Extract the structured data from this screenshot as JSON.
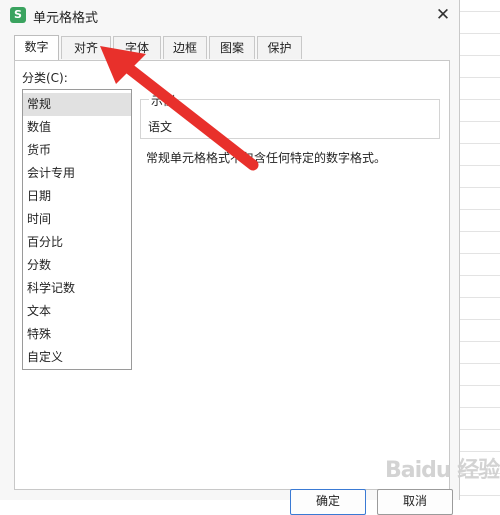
{
  "window": {
    "app_logo": "S",
    "title": "单元格格式",
    "close_glyph": "✕"
  },
  "tabs": [
    {
      "label": "数字",
      "active": true
    },
    {
      "label": "对齐",
      "active": false
    },
    {
      "label": "字体",
      "active": false
    },
    {
      "label": "边框",
      "active": false
    },
    {
      "label": "图案",
      "active": false
    },
    {
      "label": "保护",
      "active": false
    }
  ],
  "number_tab": {
    "category_label": "分类(C):",
    "categories": [
      {
        "label": "常规",
        "selected": true
      },
      {
        "label": "数值"
      },
      {
        "label": "货币"
      },
      {
        "label": "会计专用"
      },
      {
        "label": "日期"
      },
      {
        "label": "时间"
      },
      {
        "label": "百分比"
      },
      {
        "label": "分数"
      },
      {
        "label": "科学记数"
      },
      {
        "label": "文本"
      },
      {
        "label": "特殊"
      },
      {
        "label": "自定义"
      }
    ],
    "sample_legend": "示例",
    "sample_value": "语文",
    "description": "常规单元格格式不包含任何特定的数字格式。"
  },
  "buttons": {
    "ok": "确定",
    "cancel": "取消"
  },
  "overlay": {
    "arrow_color": "#e8302b",
    "watermark": "Baidu 经验"
  }
}
